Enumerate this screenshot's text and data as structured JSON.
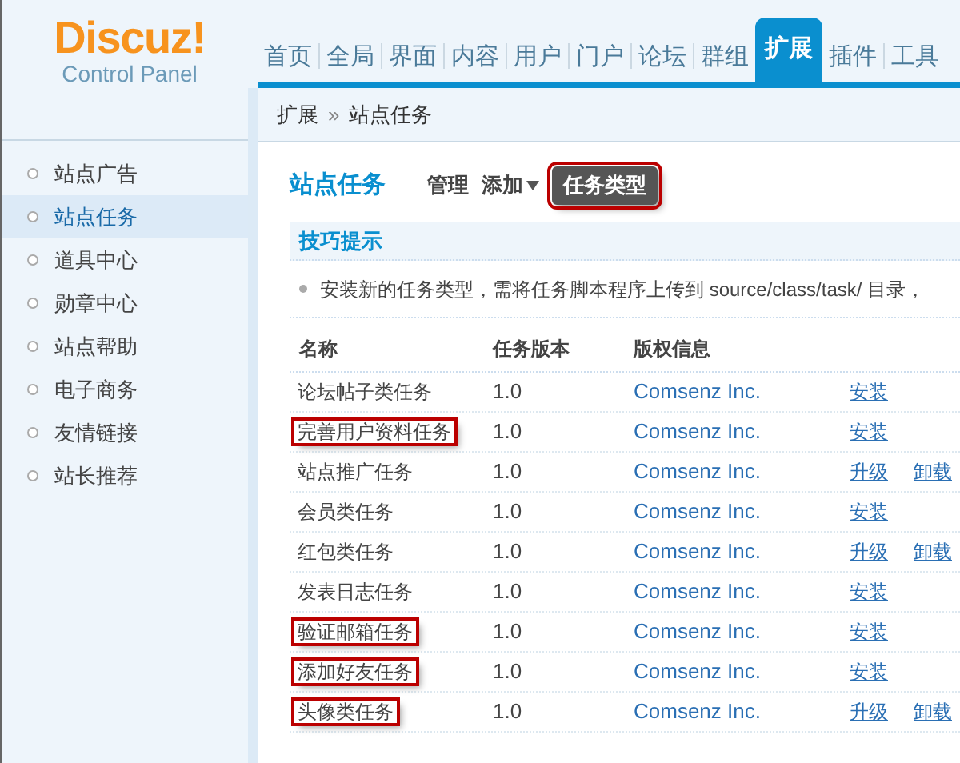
{
  "logo": {
    "brand": "Discuz!",
    "subtitle": "Control Panel"
  },
  "nav": [
    {
      "label": "首页",
      "selected": false
    },
    {
      "label": "全局",
      "selected": false
    },
    {
      "label": "界面",
      "selected": false
    },
    {
      "label": "内容",
      "selected": false
    },
    {
      "label": "用户",
      "selected": false
    },
    {
      "label": "门户",
      "selected": false
    },
    {
      "label": "论坛",
      "selected": false
    },
    {
      "label": "群组",
      "selected": false
    },
    {
      "label": "扩展",
      "selected": true
    },
    {
      "label": "插件",
      "selected": false
    },
    {
      "label": "工具",
      "selected": false
    }
  ],
  "breadcrumb": {
    "parent": "扩展",
    "separator": "»",
    "current": "站点任务"
  },
  "sidebar": [
    {
      "label": "站点广告",
      "selected": false
    },
    {
      "label": "站点任务",
      "selected": true
    },
    {
      "label": "道具中心",
      "selected": false
    },
    {
      "label": "勋章中心",
      "selected": false
    },
    {
      "label": "站点帮助",
      "selected": false
    },
    {
      "label": "电子商务",
      "selected": false
    },
    {
      "label": "友情链接",
      "selected": false
    },
    {
      "label": "站长推荐",
      "selected": false
    }
  ],
  "page_title": "站点任务",
  "subtabs": [
    {
      "label": "管理",
      "selected": false,
      "dropdown": false,
      "highlighted": false
    },
    {
      "label": "添加",
      "selected": false,
      "dropdown": true,
      "highlighted": false
    },
    {
      "label": "任务类型",
      "selected": true,
      "dropdown": false,
      "highlighted": true
    }
  ],
  "tips": {
    "title": "技巧提示",
    "text": "安装新的任务类型，需将任务脚本程序上传到 source/class/task/ 目录，"
  },
  "table": {
    "columns": [
      "名称",
      "任务版本",
      "版权信息"
    ],
    "rows": [
      {
        "name": "论坛帖子类任务",
        "version": "1.0",
        "copyright": "Comsenz Inc.",
        "actions": [
          "安装"
        ],
        "highlighted": false
      },
      {
        "name": "完善用户资料任务",
        "version": "1.0",
        "copyright": "Comsenz Inc.",
        "actions": [
          "安装"
        ],
        "highlighted": true
      },
      {
        "name": "站点推广任务",
        "version": "1.0",
        "copyright": "Comsenz Inc.",
        "actions": [
          "升级",
          "卸载"
        ],
        "highlighted": false
      },
      {
        "name": "会员类任务",
        "version": "1.0",
        "copyright": "Comsenz Inc.",
        "actions": [
          "安装"
        ],
        "highlighted": false
      },
      {
        "name": "红包类任务",
        "version": "1.0",
        "copyright": "Comsenz Inc.",
        "actions": [
          "升级",
          "卸载"
        ],
        "highlighted": false
      },
      {
        "name": "发表日志任务",
        "version": "1.0",
        "copyright": "Comsenz Inc.",
        "actions": [
          "安装"
        ],
        "highlighted": false
      },
      {
        "name": "验证邮箱任务",
        "version": "1.0",
        "copyright": "Comsenz Inc.",
        "actions": [
          "安装"
        ],
        "highlighted": true
      },
      {
        "name": "添加好友任务",
        "version": "1.0",
        "copyright": "Comsenz Inc.",
        "actions": [
          "安装"
        ],
        "highlighted": true
      },
      {
        "name": "头像类任务",
        "version": "1.0",
        "copyright": "Comsenz Inc.",
        "actions": [
          "升级",
          "卸载"
        ],
        "highlighted": true
      }
    ]
  }
}
